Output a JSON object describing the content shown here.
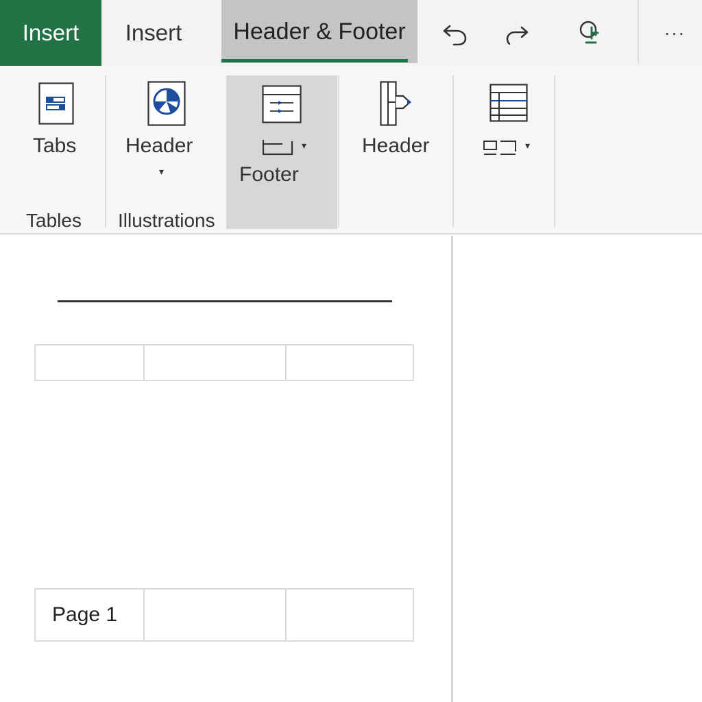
{
  "tabs": {
    "file": "Insert",
    "insert": "Insert",
    "header_footer": "Header & Footer"
  },
  "quick_access": {
    "undo_icon": "undo-icon",
    "redo_icon": "redo-icon",
    "touch_icon": "touch-mode-icon",
    "more_label": "···"
  },
  "ribbon": {
    "tables_button": "Tabs",
    "tables_group": "Tables",
    "illustrations_button": "Header",
    "illustrations_group": "Illustrations",
    "footer_button": "Footer",
    "header_button": "Header",
    "caret": "▾"
  },
  "document": {
    "header_cells": [
      "",
      "",
      ""
    ],
    "footer_cells": [
      "Page 1",
      "",
      ""
    ]
  },
  "colors": {
    "accent": "#217346",
    "icon_blue": "#1f4e9c",
    "active_tab_bg": "#c4c4c4"
  }
}
